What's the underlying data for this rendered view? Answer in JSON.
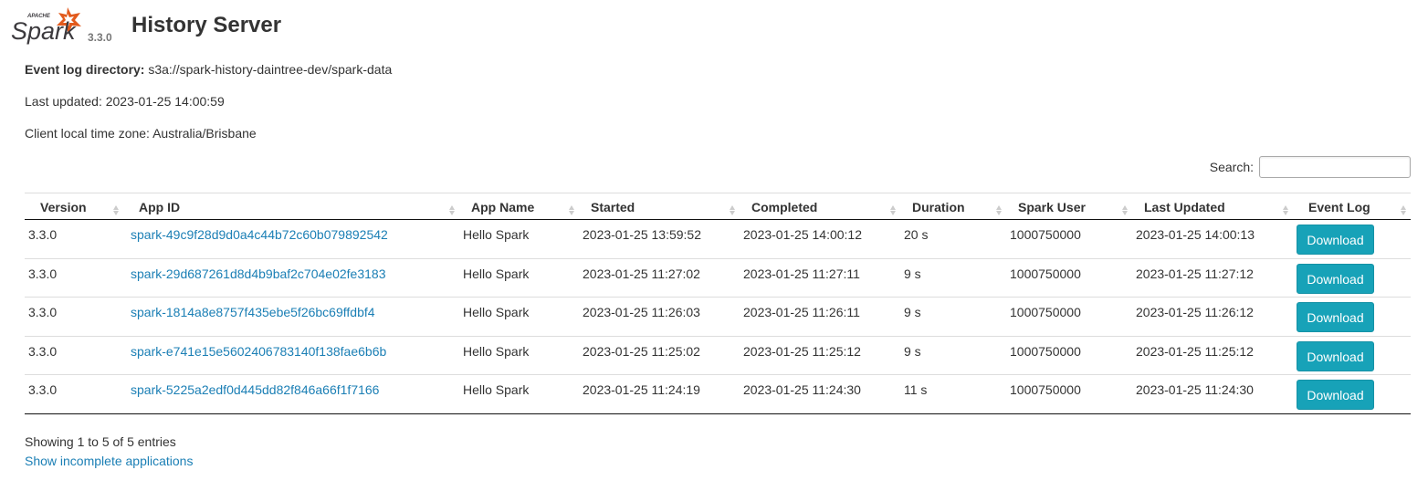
{
  "header": {
    "logo_top_text": "APACHE",
    "logo_text": "Spark",
    "version": "3.3.0",
    "title": "History Server"
  },
  "info": {
    "event_log_label": "Event log directory:",
    "event_log_value": "s3a://spark-history-daintree-dev/spark-data",
    "last_updated": "Last updated: 2023-01-25 14:00:59",
    "timezone": "Client local time zone: Australia/Brisbane"
  },
  "search": {
    "label": "Search:",
    "value": ""
  },
  "table": {
    "columns": [
      "Version",
      "App ID",
      "App Name",
      "Started",
      "Completed",
      "Duration",
      "Spark User",
      "Last Updated",
      "Event Log"
    ],
    "rows": [
      {
        "version": "3.3.0",
        "app_id": "spark-49c9f28d9d0a4c44b72c60b079892542",
        "app_name": "Hello Spark",
        "started": "2023-01-25 13:59:52",
        "completed": "2023-01-25 14:00:12",
        "duration": "20 s",
        "user": "1000750000",
        "last_updated": "2023-01-25 14:00:13",
        "event_log": "Download"
      },
      {
        "version": "3.3.0",
        "app_id": "spark-29d687261d8d4b9baf2c704e02fe3183",
        "app_name": "Hello Spark",
        "started": "2023-01-25 11:27:02",
        "completed": "2023-01-25 11:27:11",
        "duration": "9 s",
        "user": "1000750000",
        "last_updated": "2023-01-25 11:27:12",
        "event_log": "Download"
      },
      {
        "version": "3.3.0",
        "app_id": "spark-1814a8e8757f435ebe5f26bc69ffdbf4",
        "app_name": "Hello Spark",
        "started": "2023-01-25 11:26:03",
        "completed": "2023-01-25 11:26:11",
        "duration": "9 s",
        "user": "1000750000",
        "last_updated": "2023-01-25 11:26:12",
        "event_log": "Download"
      },
      {
        "version": "3.3.0",
        "app_id": "spark-e741e15e5602406783140f138fae6b6b",
        "app_name": "Hello Spark",
        "started": "2023-01-25 11:25:02",
        "completed": "2023-01-25 11:25:12",
        "duration": "9 s",
        "user": "1000750000",
        "last_updated": "2023-01-25 11:25:12",
        "event_log": "Download"
      },
      {
        "version": "3.3.0",
        "app_id": "spark-5225a2edf0d445dd82f846a66f1f7166",
        "app_name": "Hello Spark",
        "started": "2023-01-25 11:24:19",
        "completed": "2023-01-25 11:24:30",
        "duration": "11 s",
        "user": "1000750000",
        "last_updated": "2023-01-25 11:24:30",
        "event_log": "Download"
      }
    ]
  },
  "footer": {
    "entries_info": "Showing 1 to 5 of 5 entries",
    "incomplete_link": "Show incomplete applications"
  },
  "colors": {
    "link": "#1b7fb5",
    "button": "#17a2b8",
    "logo_flame": "#e25a1c",
    "logo_text": "#3c3a3e"
  }
}
